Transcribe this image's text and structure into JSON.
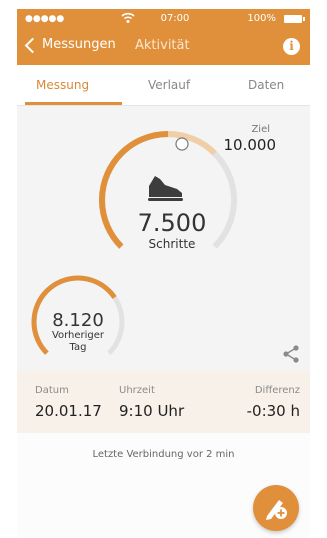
{
  "status_bar": {
    "signal": "●●●●●",
    "time": "07:00",
    "battery": "100%"
  },
  "nav": {
    "back_label": "Messungen",
    "title": "Aktivität",
    "info_glyph": "i"
  },
  "tabs": [
    {
      "label": "Messung",
      "active": true
    },
    {
      "label": "Verlauf",
      "active": false
    },
    {
      "label": "Daten",
      "active": false
    }
  ],
  "activity": {
    "goal_label": "Ziel",
    "goal_value": "10.000",
    "steps_value": "7.500",
    "steps_label": "Schritte",
    "progress_fraction": 0.75,
    "previous_value": "8.120",
    "previous_label_line1": "Vorheriger",
    "previous_label_line2": "Tag"
  },
  "details": {
    "date_label": "Datum",
    "date_value": "20.01.17",
    "time_label": "Uhrzeit",
    "time_value": "9:10 Uhr",
    "diff_label": "Differenz",
    "diff_value": "-0:30 h"
  },
  "footer": {
    "connection_text": "Letzte Verbindung vor 2 min"
  },
  "colors": {
    "accent": "#e0903b",
    "arc_light": "#f0cfa8",
    "track": "#e2e2e2"
  },
  "icons": [
    "wifi-icon",
    "battery-icon",
    "back-chevron-icon",
    "info-icon",
    "shoe-icon",
    "share-icon",
    "add-measurement-icon"
  ]
}
